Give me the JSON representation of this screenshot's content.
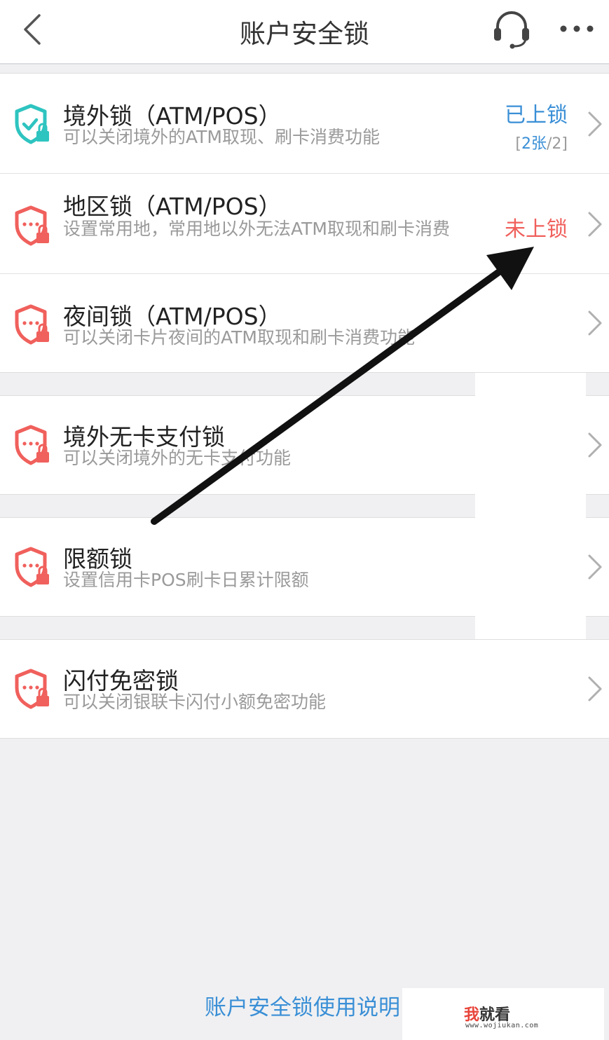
{
  "header": {
    "title": "账户安全锁",
    "back_icon": "chevron-left-icon",
    "support_icon": "headset-icon",
    "more_icon": "more-dots-icon"
  },
  "locks": [
    {
      "title": "境外锁（ATM/POS）",
      "desc": "可以关闭境外的ATM取现、刷卡消费功能",
      "status": "已上锁",
      "count_open": "[",
      "count_cards": "2张",
      "count_total": "/2]",
      "icon": "shield-check-lock-icon",
      "color": "#2ec4c0"
    },
    {
      "title": "地区锁（ATM/POS）",
      "desc": "设置常用地，常用地以外无法ATM取现和刷卡消费",
      "status": "未上锁",
      "icon": "shield-dots-lock-icon",
      "color": "#f0605c"
    },
    {
      "title": "夜间锁（ATM/POS）",
      "desc": "可以关闭卡片夜间的ATM取现和刷卡消费功能",
      "icon": "shield-dots-lock-icon",
      "color": "#f0605c"
    },
    {
      "title": "境外无卡支付锁",
      "desc": "可以关闭境外的无卡支付功能",
      "icon": "shield-dots-lock-icon",
      "color": "#f0605c"
    },
    {
      "title": "限额锁",
      "desc": "设置信用卡POS刷卡日累计限额",
      "icon": "shield-dots-lock-icon",
      "color": "#f0605c"
    },
    {
      "title": "闪付免密锁",
      "desc": "可以关闭银联卡闪付小额免密功能",
      "icon": "shield-dots-lock-icon",
      "color": "#f0605c"
    }
  ],
  "footer": {
    "link": "账户安全锁使用说明"
  },
  "watermark": {
    "brand_first": "我",
    "brand_rest": "就看",
    "url": "www.wojiukan.com"
  },
  "colors": {
    "accent": "#3a8fd6",
    "danger": "#f0605c",
    "teal": "#2ec4c0"
  }
}
